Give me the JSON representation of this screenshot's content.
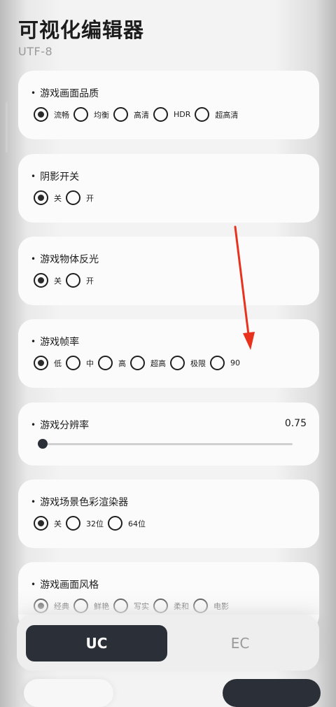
{
  "header": {
    "title": "可视化编辑器",
    "subtitle": "UTF-8"
  },
  "settings": [
    {
      "title": "游戏画面品质",
      "options": [
        "流畅",
        "均衡",
        "高清",
        "HDR",
        "超高清"
      ],
      "selected": 0
    },
    {
      "title": "阴影开关",
      "options": [
        "关",
        "开"
      ],
      "selected": 0
    },
    {
      "title": "游戏物体反光",
      "options": [
        "关",
        "开"
      ],
      "selected": 0
    },
    {
      "title": "游戏帧率",
      "options": [
        "低",
        "中",
        "高",
        "超高",
        "极限",
        "90"
      ],
      "selected": 0
    },
    {
      "title": "游戏分辨率",
      "value": "0.75"
    },
    {
      "title": "游戏场景色彩渲染器",
      "options": [
        "关",
        "32位",
        "64位"
      ],
      "selected": 0
    },
    {
      "title": "游戏画面风格",
      "options": [
        "经典",
        "鲜艳",
        "写实",
        "柔和",
        "电影"
      ],
      "selected": 0
    }
  ],
  "tabs": {
    "uc": "UC",
    "ec": "EC"
  },
  "colors": {
    "accent": "#2b2f38",
    "arrow": "#e8321e",
    "card": "#fbfbfb"
  }
}
